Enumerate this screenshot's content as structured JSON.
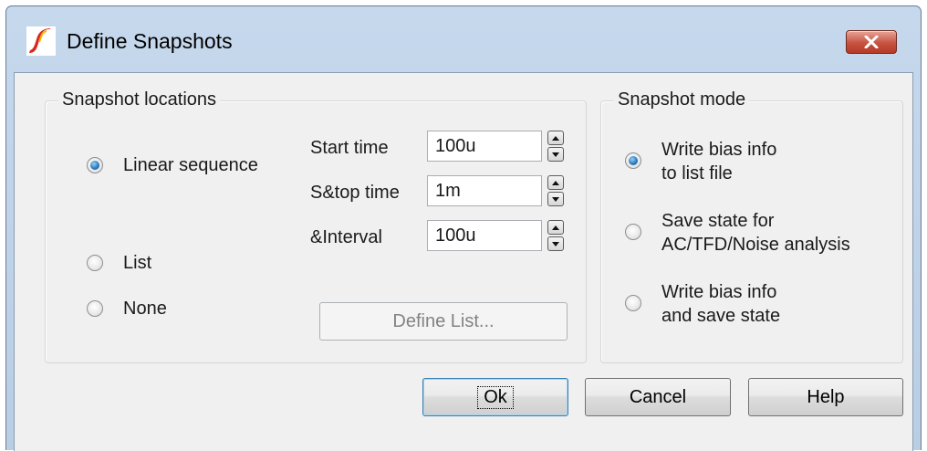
{
  "window": {
    "title": "Define Snapshots"
  },
  "locations": {
    "legend": "Snapshot locations",
    "options": [
      {
        "label": "Linear sequence",
        "selected": true
      },
      {
        "label": "List",
        "selected": false
      },
      {
        "label": "None",
        "selected": false
      }
    ],
    "fields": [
      {
        "label": "Start time",
        "value": "100u"
      },
      {
        "label": "S&top time",
        "value": "1m"
      },
      {
        "label": "&Interval",
        "value": "100u"
      }
    ],
    "define_list_label": "Define List..."
  },
  "mode": {
    "legend": "Snapshot mode",
    "options": [
      {
        "label": "Write bias info\nto list file",
        "selected": true
      },
      {
        "label": "Save state for\nAC/TFD/Noise analysis",
        "selected": false
      },
      {
        "label": "Write bias info\nand save state",
        "selected": false
      }
    ]
  },
  "buttons": {
    "ok": "Ok",
    "cancel": "Cancel",
    "help": "Help"
  },
  "colors": {
    "accent": "#2a7cc3",
    "close": "#c75240",
    "logo": "#d9261c"
  }
}
